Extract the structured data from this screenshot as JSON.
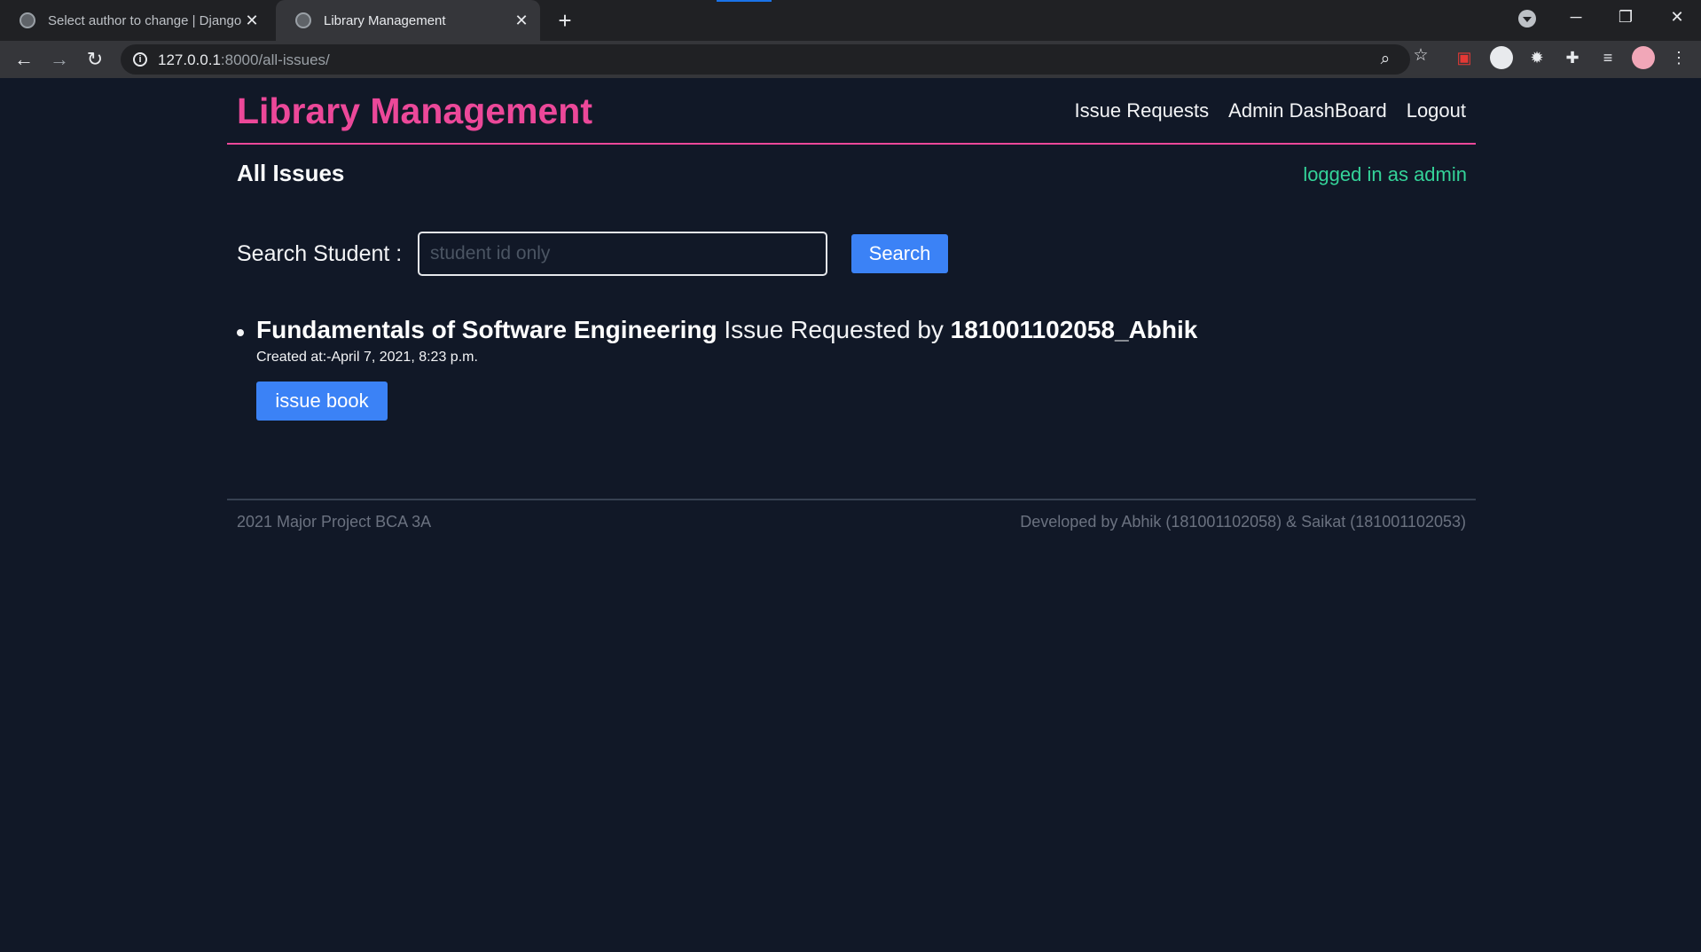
{
  "browser": {
    "tabs": [
      {
        "title": "Select author to change | Django"
      },
      {
        "title": "Library Management"
      }
    ],
    "url_host": "127.0.0.1",
    "url_rest": ":8000/all-issues/"
  },
  "header": {
    "brand": "Library Management",
    "nav": [
      "Issue Requests",
      "Admin DashBoard",
      "Logout"
    ]
  },
  "main": {
    "title": "All Issues",
    "login_status": "logged in as admin",
    "search": {
      "label": "Search Student :",
      "placeholder": "student id only",
      "button": "Search"
    },
    "issues": [
      {
        "book": "Fundamentals of Software Engineering",
        "middle_text": " Issue Requested by ",
        "student": "181001102058_Abhik",
        "created": "Created at:-April 7, 2021, 8:23 p.m.",
        "action": "issue book"
      }
    ]
  },
  "footer": {
    "left": "2021 Major Project BCA 3A",
    "right": "Developed by Abhik (181001102058) & Saikat (181001102053)"
  },
  "colors": {
    "background": "#111827",
    "brand": "#ec4899",
    "accent": "#3b82f6",
    "status": "#34d399"
  }
}
